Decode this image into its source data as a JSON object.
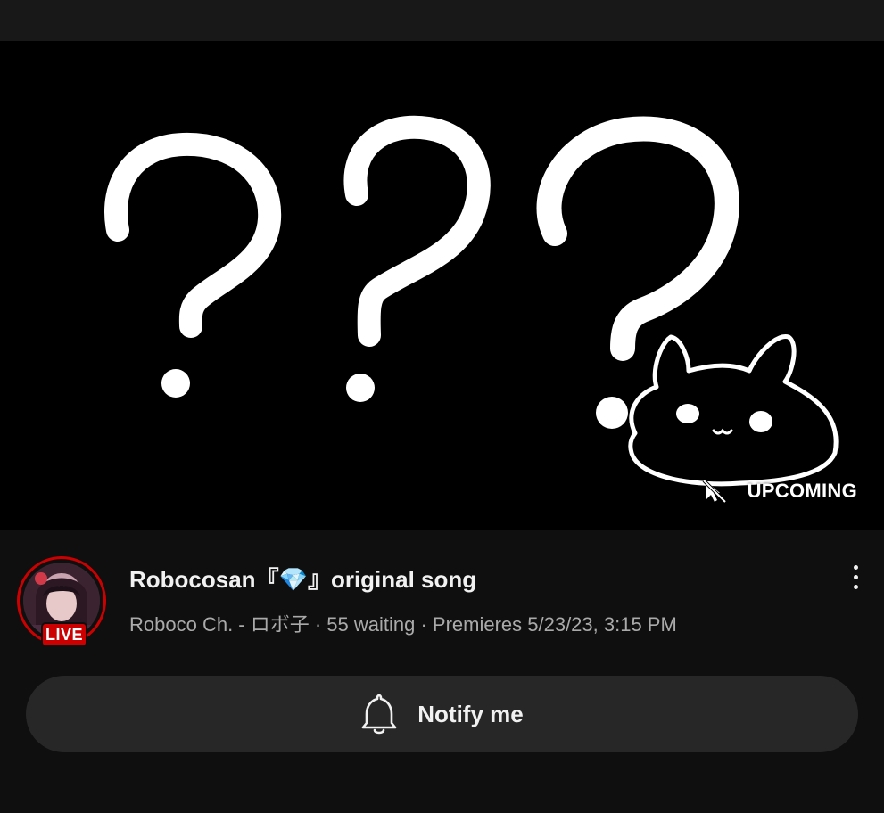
{
  "thumbnail": {
    "status_label": "UPCOMING",
    "cursor_icon": "cursor-off-icon"
  },
  "video": {
    "title": "Robocosan『💎』original song",
    "channel": "Roboco Ch. - ロボ子",
    "waiting": "55 waiting",
    "premiere": "Premieres 5/23/23, 3:15 PM",
    "meta_line": "Roboco Ch. - ロボ子 · 55 waiting · Premieres 5/23/23, 3:15 PM"
  },
  "channel_avatar": {
    "live_badge": "LIVE",
    "ring_color": "#cc0000"
  },
  "actions": {
    "more_icon": "more-vertical-icon",
    "notify_label": "Notify me",
    "notify_icon": "bell-icon"
  },
  "colors": {
    "background": "#0f0f0f",
    "button_bg": "#272727",
    "live_red": "#cc0000",
    "meta_text": "#aaaaaa"
  }
}
